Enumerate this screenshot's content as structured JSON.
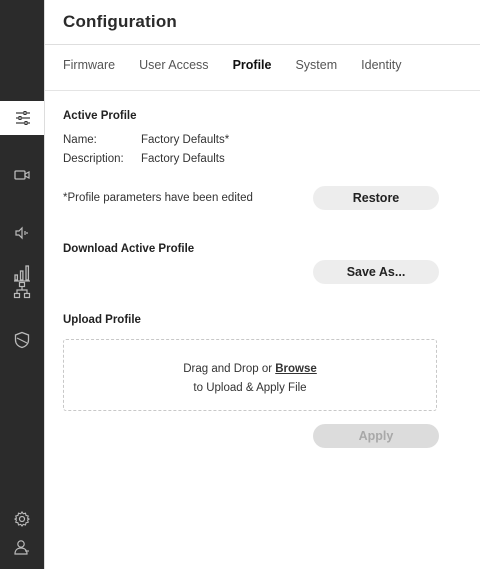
{
  "page": {
    "title": "Configuration"
  },
  "tabs": [
    {
      "label": "Firmware",
      "active": false
    },
    {
      "label": "User Access",
      "active": false
    },
    {
      "label": "Profile",
      "active": true
    },
    {
      "label": "System",
      "active": false
    },
    {
      "label": "Identity",
      "active": false
    }
  ],
  "sidebar": {
    "items": [
      {
        "icon": "bar-chart-icon",
        "active": false
      },
      {
        "icon": "sliders-icon",
        "active": true
      },
      {
        "icon": "camera-icon",
        "active": false
      },
      {
        "icon": "speaker-icon",
        "active": false
      },
      {
        "icon": "network-icon",
        "active": false
      },
      {
        "icon": "shield-icon",
        "active": false
      },
      {
        "icon": "gear-icon",
        "active": false
      },
      {
        "icon": "user-icon",
        "active": false
      }
    ]
  },
  "active_profile": {
    "heading": "Active Profile",
    "name_label": "Name:",
    "name_value": "Factory Defaults*",
    "desc_label": "Description:",
    "desc_value": "Factory Defaults",
    "edited_note": "*Profile parameters have been edited",
    "restore_label": "Restore"
  },
  "download": {
    "heading": "Download Active Profile",
    "save_label": "Save As..."
  },
  "upload": {
    "heading": "Upload Profile",
    "drop_prefix": "Drag and Drop or ",
    "browse_label": "Browse",
    "drop_line2": "to Upload & Apply File",
    "apply_label": "Apply"
  },
  "colors": {
    "sidebar_bg": "#2b2b2b",
    "button_bg": "#ededed",
    "disabled_bg": "#dcdcdc"
  }
}
